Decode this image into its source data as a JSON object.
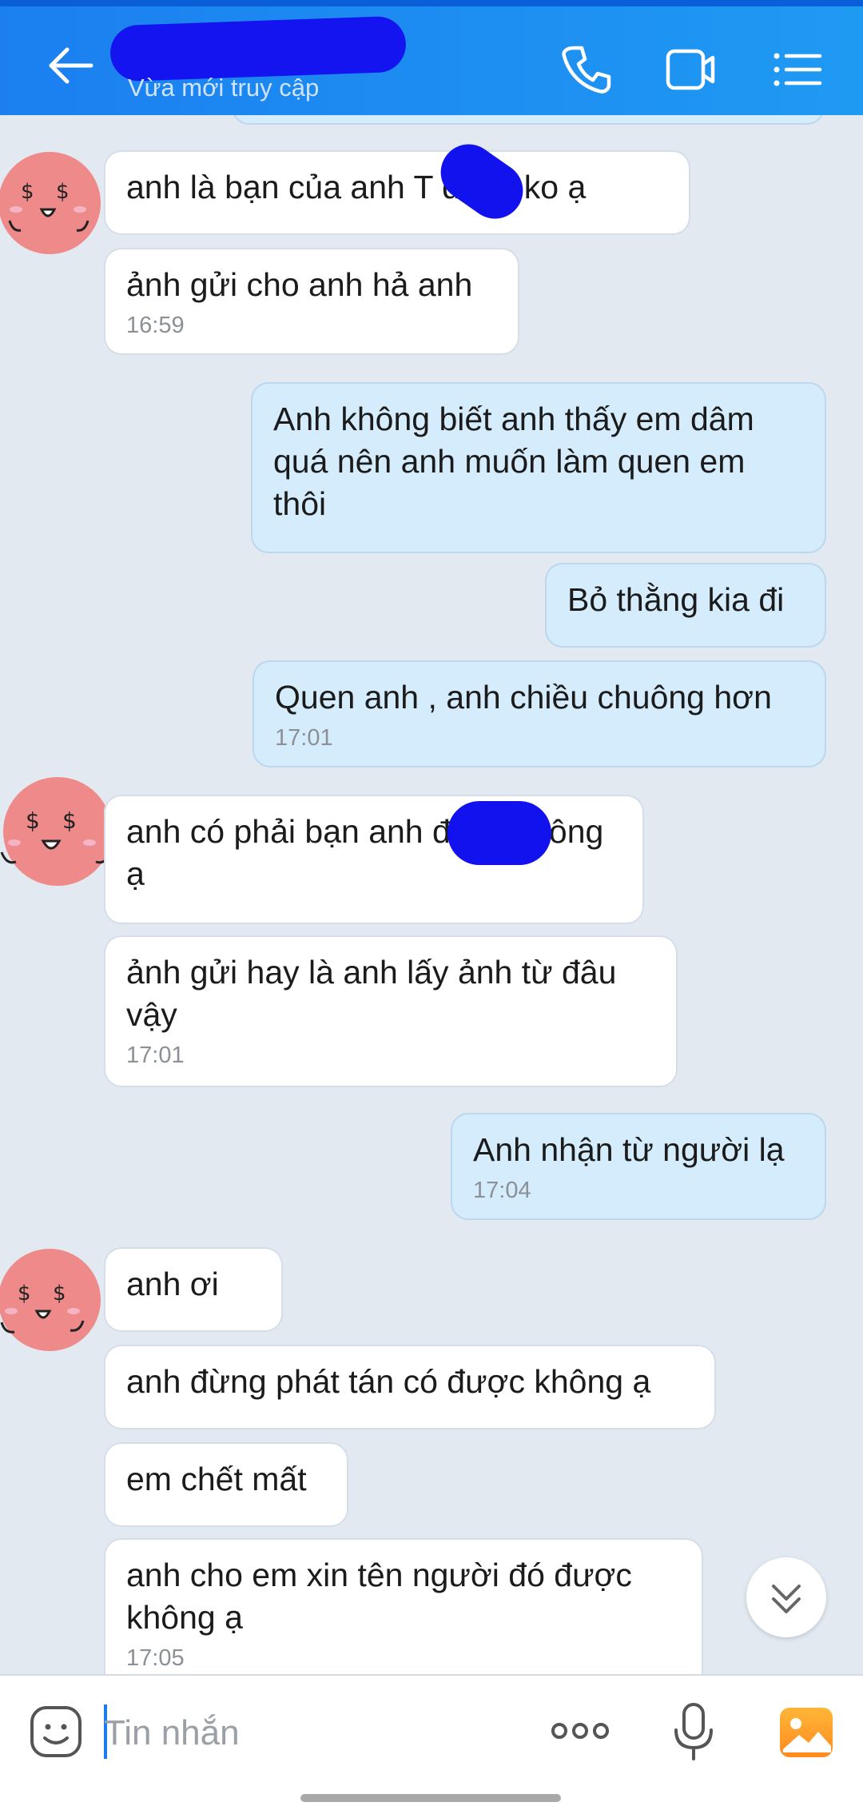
{
  "header": {
    "status": "Vừa mới truy cập"
  },
  "messages": [
    {
      "side": "them",
      "text": "anh là bạn của anh T  đúng ko ạ",
      "time": ""
    },
    {
      "side": "them",
      "text": "ảnh gửi cho anh hả anh",
      "time": "16:59"
    },
    {
      "side": "me",
      "text": "Anh không biết anh thấy em dâm quá nên anh muốn làm quen em thôi",
      "time": ""
    },
    {
      "side": "me",
      "text": "Bỏ thằng kia đi",
      "time": ""
    },
    {
      "side": "me",
      "text": "Quen anh , anh chiều chuông hơn",
      "time": "17:01"
    },
    {
      "side": "them",
      "text": "anh có phải bạn anh         đúng không ạ",
      "time": ""
    },
    {
      "side": "them",
      "text": "ảnh gửi hay là anh lấy ảnh từ đâu vậy",
      "time": "17:01"
    },
    {
      "side": "me",
      "text": "Anh nhận từ người lạ",
      "time": "17:04"
    },
    {
      "side": "them",
      "text": "anh ơi",
      "time": ""
    },
    {
      "side": "them",
      "text": "anh đừng phát tán có được không ạ",
      "time": ""
    },
    {
      "side": "them",
      "text": "em chết mất",
      "time": ""
    },
    {
      "side": "them",
      "text": "anh cho em xin tên người đó được không ạ",
      "time": "17:05"
    }
  ],
  "input": {
    "placeholder": "Tin nhắn"
  },
  "colors": {
    "header": "#1b8af1",
    "outgoing_bubble": "#d5ecfc",
    "incoming_bubble": "#ffffff",
    "background": "#e2e9f1",
    "avatar": "#ef8a8a"
  },
  "icons": [
    "back-arrow-icon",
    "phone-icon",
    "video-call-icon",
    "list-menu-icon",
    "sticker-icon",
    "more-options-icon",
    "microphone-icon",
    "photo-icon",
    "chevron-double-down-icon"
  ]
}
